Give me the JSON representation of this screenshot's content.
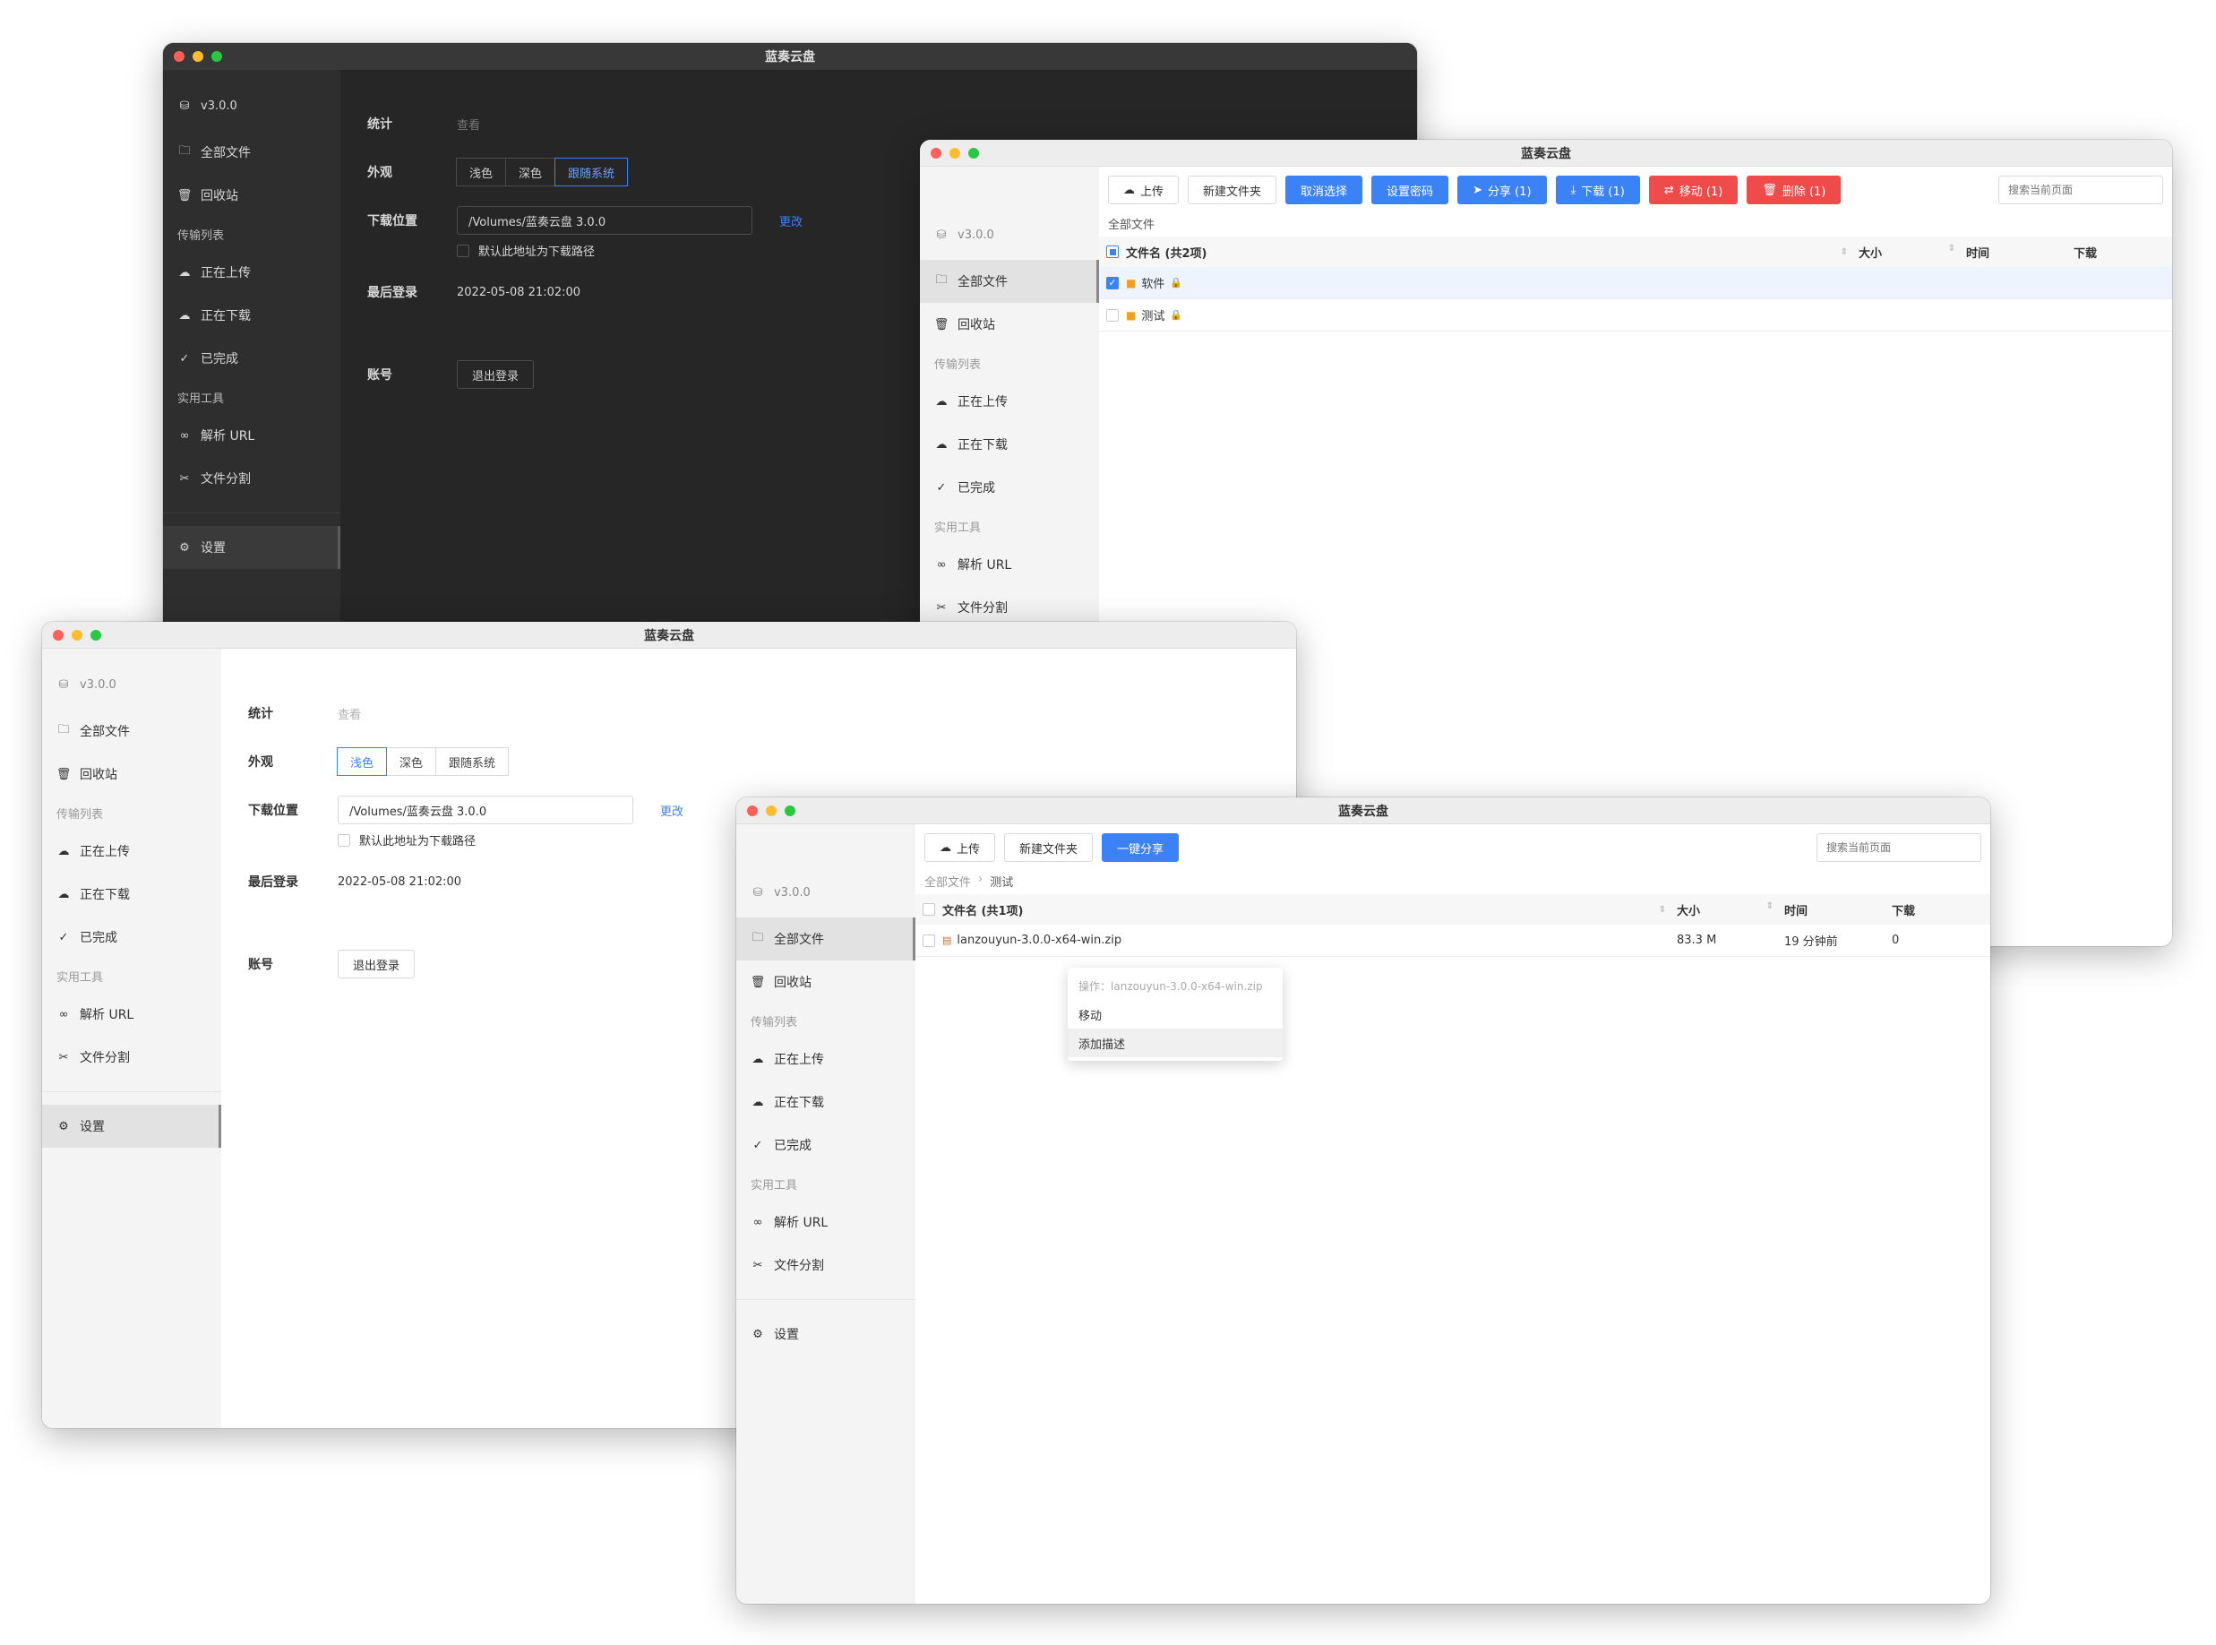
{
  "app_title": "蓝奏云盘",
  "sidebar": {
    "version": "v3.0.0",
    "all_files": "全部文件",
    "recycle": "回收站",
    "transfer_group": "传输列表",
    "uploading": "正在上传",
    "downloading": "正在下载",
    "completed": "已完成",
    "tools_group": "实用工具",
    "parse_url": "解析 URL",
    "split_file": "文件分割",
    "settings": "设置"
  },
  "settings": {
    "stats_label": "统计",
    "stats_link": "查看",
    "appearance_label": "外观",
    "appearance_options": [
      "浅色",
      "深色",
      "跟随系统"
    ],
    "download_label": "下载位置",
    "download_path": "/Volumes/蓝奏云盘 3.0.0",
    "change_link": "更改",
    "default_path_checkbox": "默认此地址为下载路径",
    "last_login_label": "最后登录",
    "last_login_value": "2022-05-08 21:02:00",
    "account_label": "账号",
    "logout_button": "退出登录"
  },
  "dark_window": {
    "selected_appearance": "跟随系统"
  },
  "light_settings_window": {
    "selected_appearance": "浅色"
  },
  "files_window_1": {
    "toolbar": {
      "upload": "上传",
      "new_folder": "新建文件夹",
      "cancel_select": "取消选择",
      "set_password": "设置密码",
      "share": "分享 (1)",
      "download": "下载 (1)",
      "move": "移动 (1)",
      "delete": "删除 (1)"
    },
    "search_placeholder": "搜索当前页面",
    "breadcrumb": "全部文件",
    "columns": {
      "name": "文件名 (共2项)",
      "size": "大小",
      "time": "时间",
      "download": "下载"
    },
    "rows": [
      {
        "name": "软件",
        "selected": true
      },
      {
        "name": "测试",
        "selected": false
      }
    ]
  },
  "files_window_2": {
    "toolbar": {
      "upload": "上传",
      "new_folder": "新建文件夹",
      "one_click_share": "一键分享"
    },
    "search_placeholder": "搜索当前页面",
    "breadcrumb": [
      "全部文件",
      "测试"
    ],
    "columns": {
      "name": "文件名 (共1项)",
      "size": "大小",
      "time": "时间",
      "download": "下载"
    },
    "rows": [
      {
        "name": "lanzouyun-3.0.0-x64-win.zip",
        "size": "83.3 M",
        "time": "19 分钟前",
        "download": "0"
      }
    ],
    "context_menu": {
      "title": "操作：lanzouyun-3.0.0-x64-win.zip",
      "move": "移动",
      "add_desc": "添加描述"
    }
  },
  "colors": {
    "accent": "#3b82f6",
    "danger": "#f04b4b",
    "dark_bg": "#262626"
  }
}
